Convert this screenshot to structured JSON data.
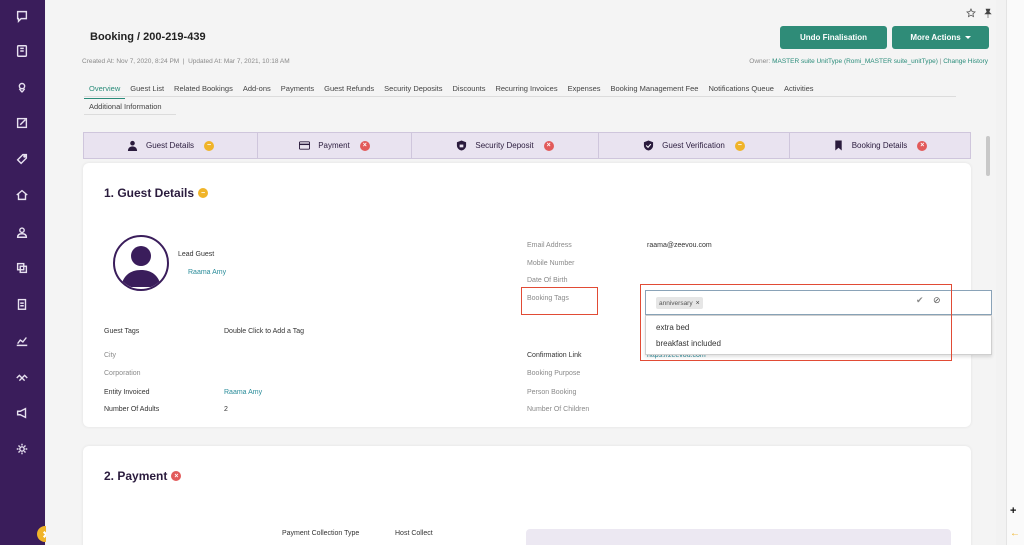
{
  "sidebar": {
    "icons": [
      "chat-icon",
      "book-icon",
      "map-pin-icon",
      "edit-icon",
      "tag-icon",
      "home-icon",
      "user-icon",
      "copy-icon",
      "clipboard-icon",
      "chart-icon",
      "handshake-icon",
      "megaphone-icon",
      "gear-icon"
    ]
  },
  "header": {
    "title_prefix": "Booking",
    "title_sep": " / ",
    "title_id": "200-219-439",
    "meta": "Created At: Nov 7, 2020, 8:24 PM  |  Updated At: Mar 7, 2021, 10:18 AM",
    "owner_prefix": "Owner: ",
    "owner_value": "MASTER suite UnitType (Romi_MASTER suite_unitType)",
    "owner_sep": " | ",
    "change_history": "Change History",
    "undo_label": "Undo Finalisation",
    "more_label": "More Actions"
  },
  "tabs": [
    "Overview",
    "Guest List",
    "Related Bookings",
    "Add-ons",
    "Payments",
    "Guest Refunds",
    "Security Deposits",
    "Discounts",
    "Recurring Invoices",
    "Expenses",
    "Booking Management Fee",
    "Notifications Queue",
    "Activities"
  ],
  "tabs_row2": [
    "Additional Information"
  ],
  "steps": [
    {
      "label": "Guest Details",
      "status": "−"
    },
    {
      "label": "Payment",
      "status": "×"
    },
    {
      "label": "Security Deposit",
      "status": "×"
    },
    {
      "label": "Guest Verification",
      "status": "−"
    },
    {
      "label": "Booking Details",
      "status": "×"
    }
  ],
  "guest_details": {
    "title": "1. Guest Details",
    "status": "−",
    "lead_guest_label": "Lead Guest",
    "lead_guest_name": "Raama Amy",
    "email_label": "Email Address",
    "email_value": "raama@zeevou.com",
    "mobile_label": "Mobile Number",
    "dob_label": "Date Of Birth",
    "booking_tags_label": "Booking Tags",
    "guest_tags_label": "Guest Tags",
    "guest_tags_value": "Double Click to Add a Tag",
    "city_label": "City",
    "corporation_label": "Corporation",
    "entity_invoiced_label": "Entity Invoiced",
    "entity_invoiced_value": "Raama Amy",
    "adults_label": "Number Of Adults",
    "adults_value": "2",
    "confirmation_label": "Confirmation Link",
    "confirmation_value": "https://zeevou.com",
    "purpose_label": "Booking Purpose",
    "person_booking_label": "Person Booking",
    "children_label": "Number Of Children"
  },
  "tag_editor": {
    "chip": "anniversary",
    "chip_remove": "×",
    "ok": "✔",
    "cancel": "⊘",
    "options": [
      "extra bed",
      "breakfast included"
    ]
  },
  "payment": {
    "title": "2. Payment",
    "status": "×",
    "collection_type_label": "Payment Collection Type",
    "collection_type_value": "Host Collect"
  },
  "colors": {
    "sidebar": "#3a1d5b",
    "accent_green": "#2f8c78",
    "highlight_red": "#e14b35",
    "status_minus": "#f0b429",
    "status_x": "#e25a5a"
  }
}
